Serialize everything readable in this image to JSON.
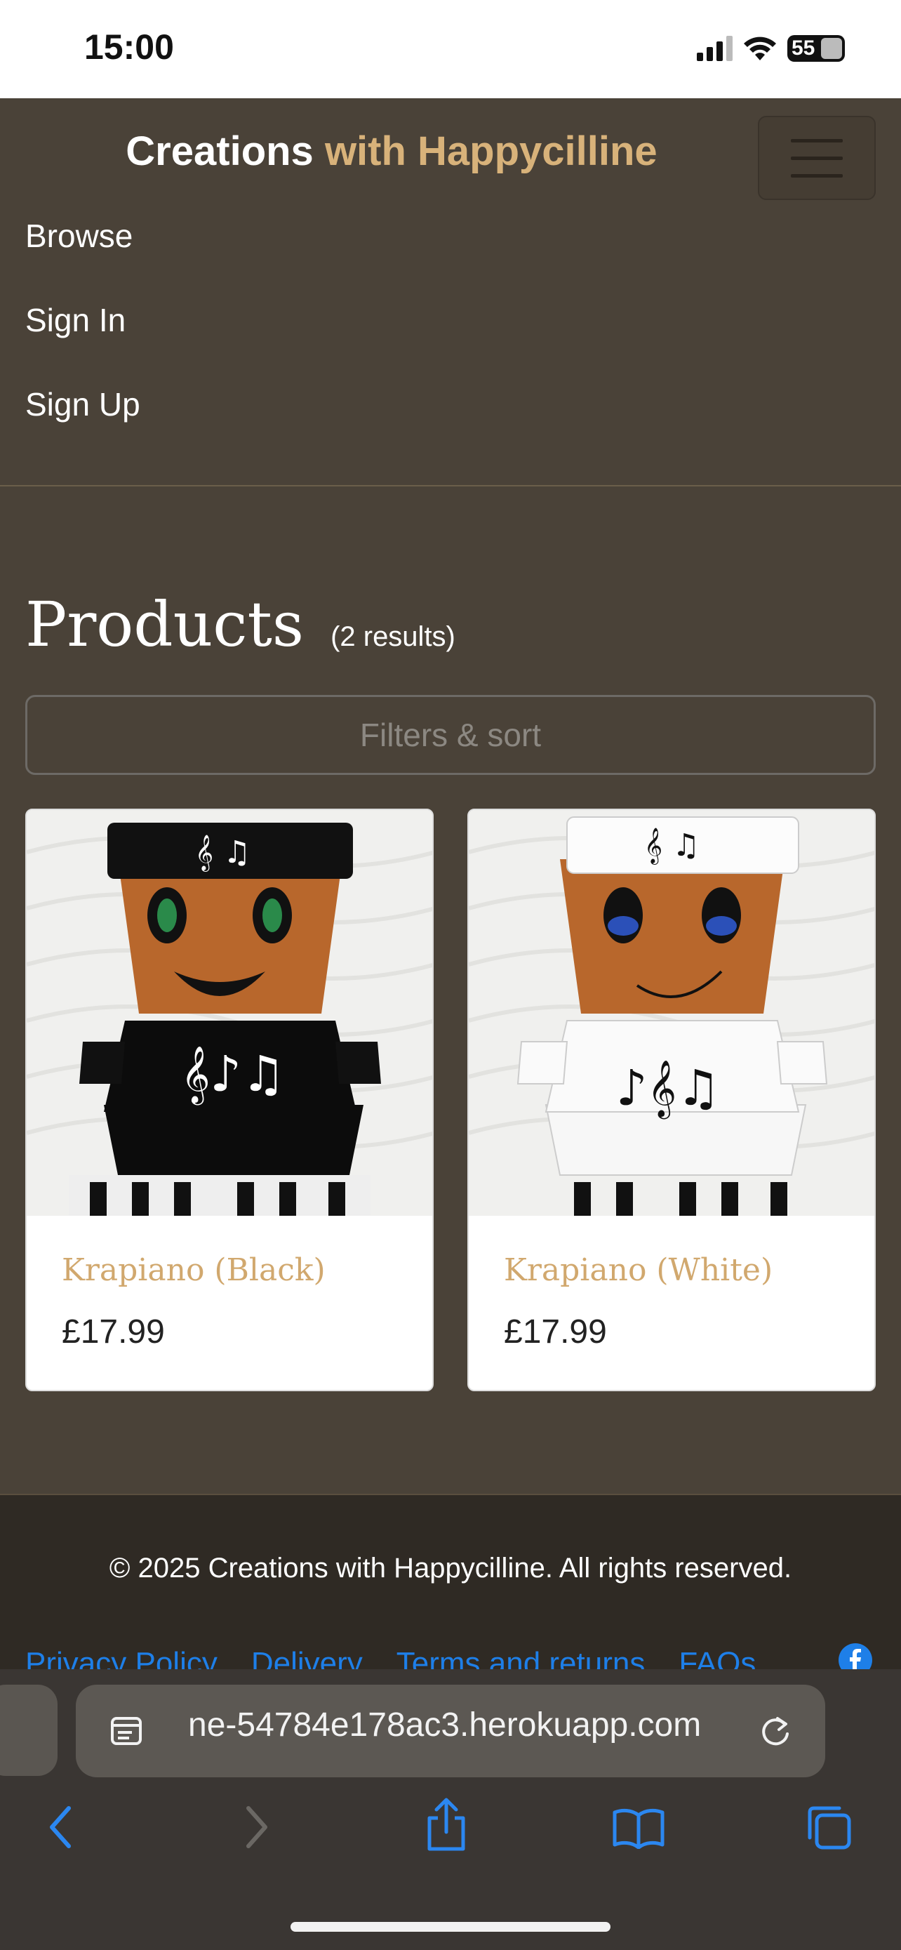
{
  "status": {
    "time": "15:00",
    "battery": "55"
  },
  "brand": {
    "part1": "Creations",
    "part2": "with Happycilline"
  },
  "nav": {
    "links": [
      "Browse",
      "Sign In",
      "Sign Up"
    ]
  },
  "products": {
    "title": "Products",
    "results": "(2 results)",
    "filter_label": "Filters & sort",
    "items": [
      {
        "name": "Krapiano (Black)",
        "price": "£17.99"
      },
      {
        "name": "Krapiano (White)",
        "price": "£17.99"
      }
    ]
  },
  "footer": {
    "copyright": "© 2025 Creations with Happycilline. All rights reserved.",
    "links": [
      "Privacy Policy",
      "Delivery",
      "Terms and returns",
      "FAQs"
    ]
  },
  "browser": {
    "url": "ne-54784e178ac3.herokuapp.com"
  },
  "colors": {
    "accent": "#d8b27a",
    "background": "#4a4238",
    "link": "#1e7fe8"
  }
}
